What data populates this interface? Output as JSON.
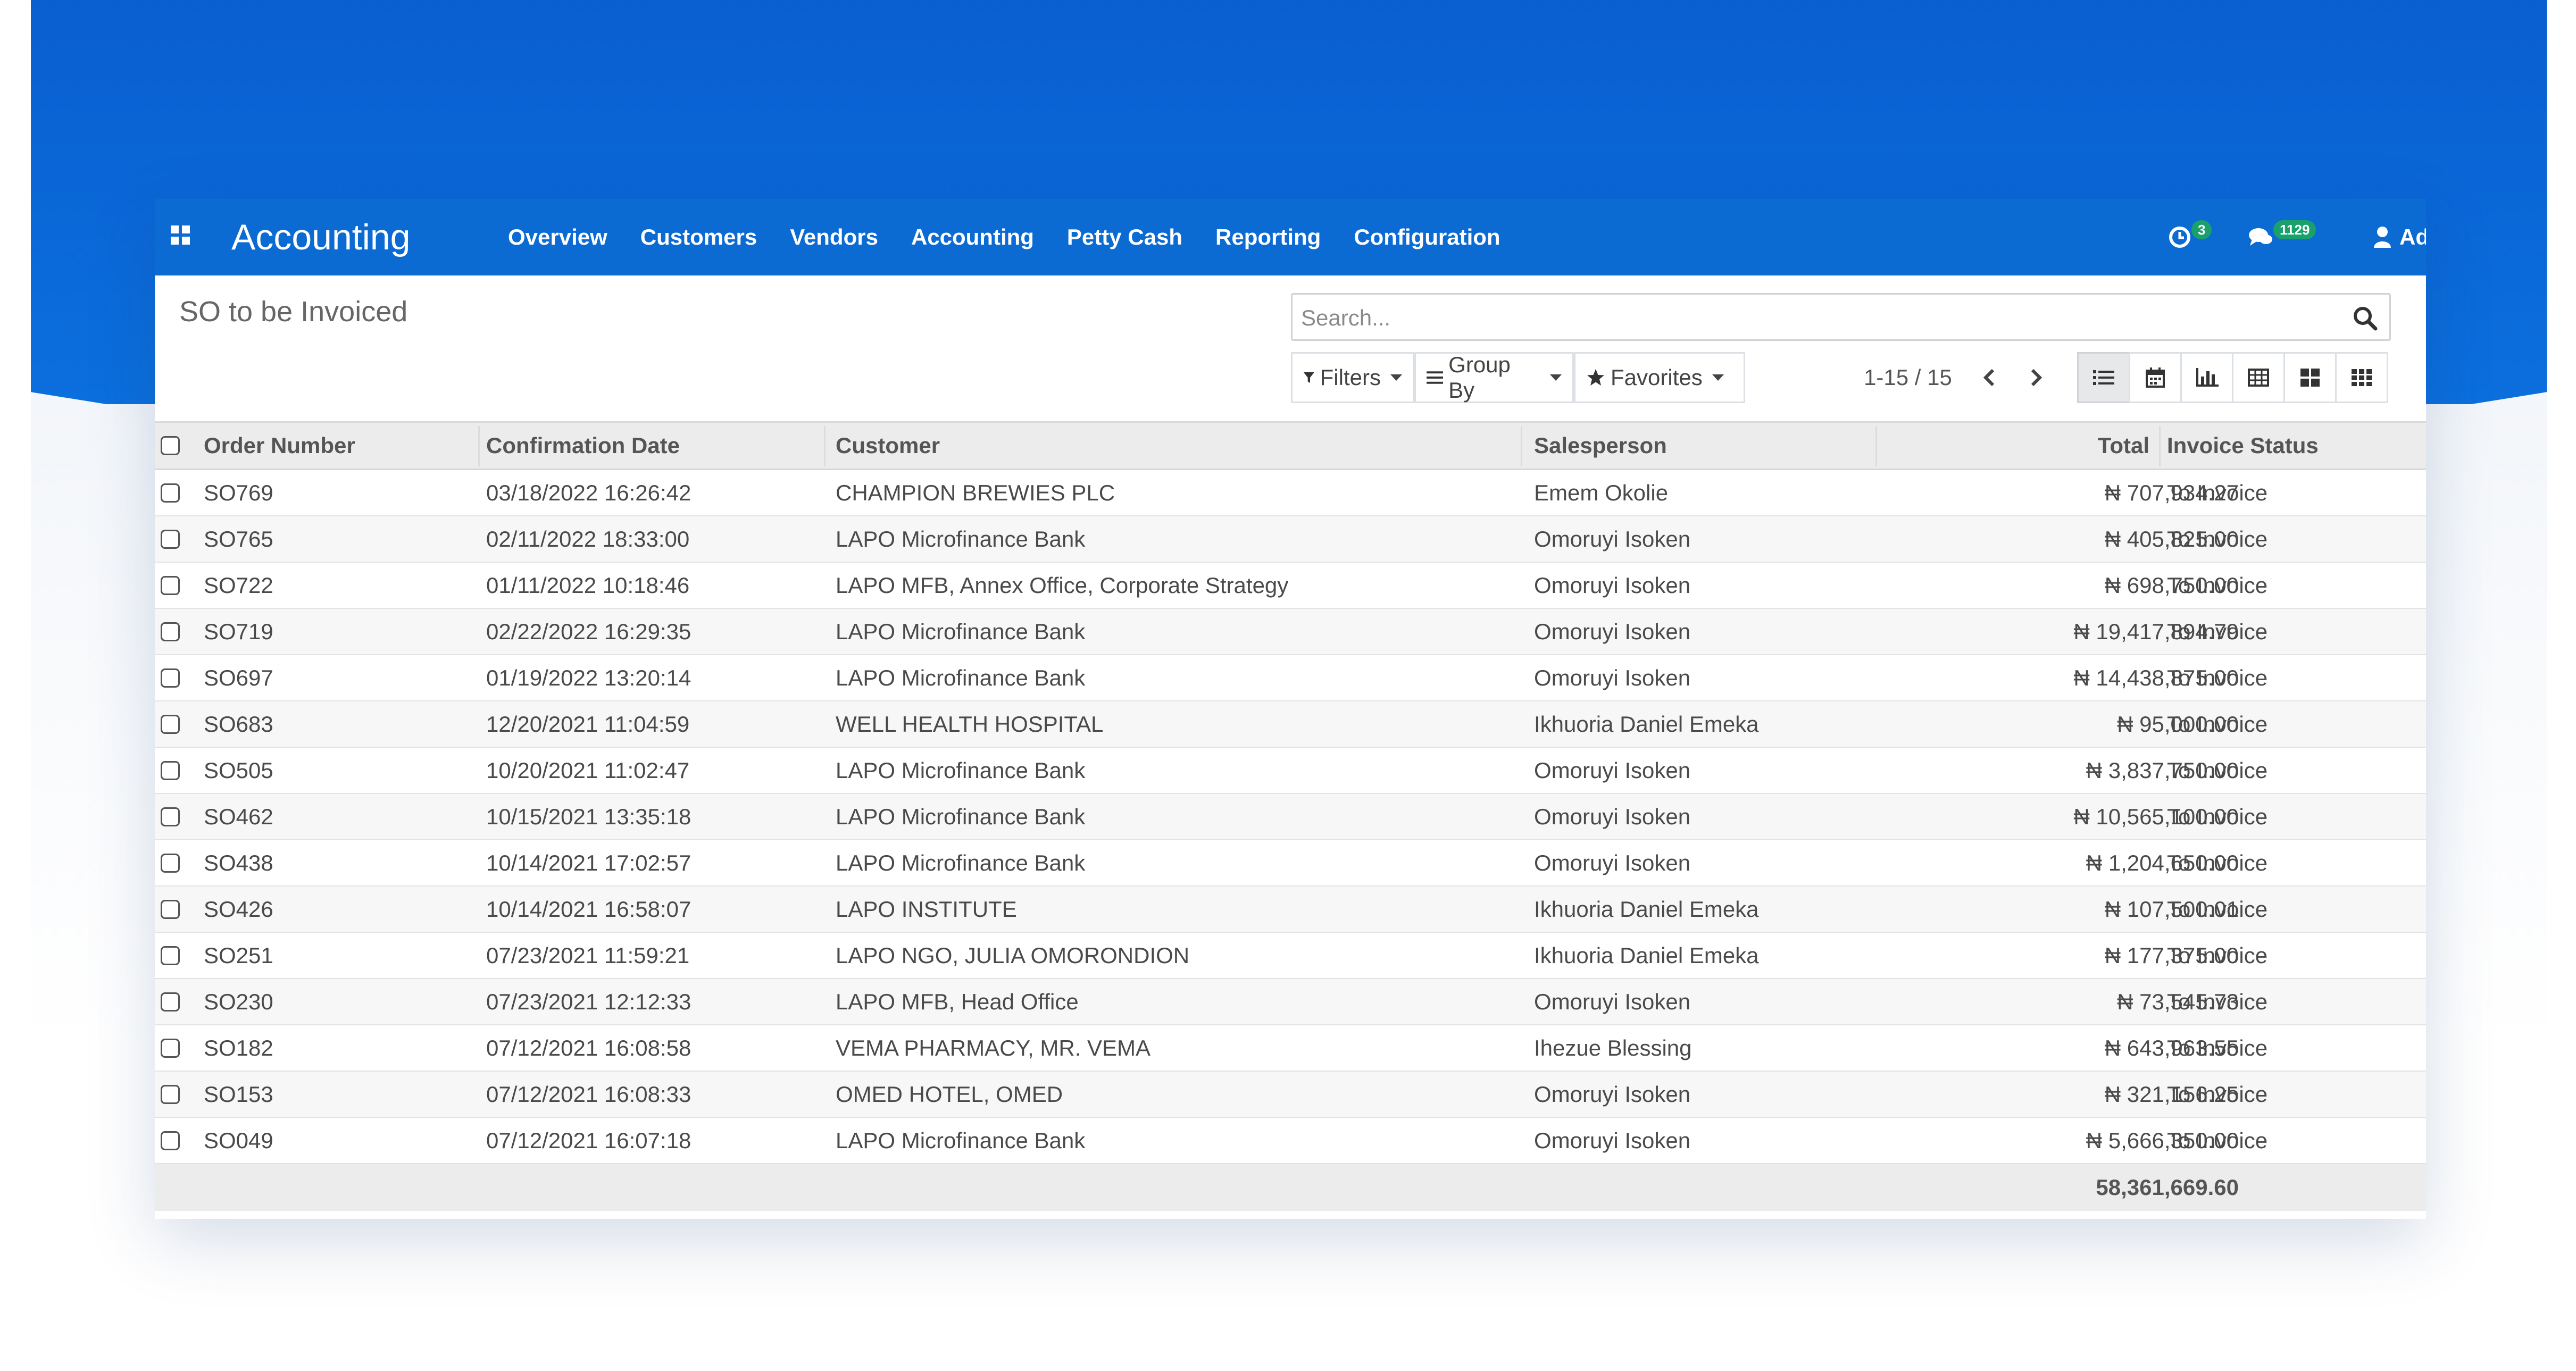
{
  "app": {
    "title": "Accounting",
    "menu": [
      "Overview",
      "Customers",
      "Vendors",
      "Accounting",
      "Petty Cash",
      "Reporting",
      "Configuration"
    ],
    "activity_count": "3",
    "message_count": "1129",
    "user": "Administrator"
  },
  "control_panel": {
    "page_title": "SO to be Invoiced",
    "search_placeholder": "Search...",
    "filters_label": "Filters",
    "groupby_label": "Group By",
    "favorites_label": "Favorites",
    "pager_text": "1-15 / 15"
  },
  "table": {
    "columns": [
      "Order Number",
      "Confirmation Date",
      "Customer",
      "Salesperson",
      "Total",
      "Invoice Status"
    ],
    "rows": [
      {
        "order": "SO769",
        "date": "03/18/2022 16:26:42",
        "customer": "CHAMPION BREWIES PLC",
        "salesperson": "Emem Okolie",
        "total": "₦ 707,934.27",
        "status": "To Invoice"
      },
      {
        "order": "SO765",
        "date": "02/11/2022 18:33:00",
        "customer": "LAPO Microfinance Bank",
        "salesperson": "Omoruyi Isoken",
        "total": "₦ 405,825.00",
        "status": "To Invoice"
      },
      {
        "order": "SO722",
        "date": "01/11/2022 10:18:46",
        "customer": "LAPO MFB, Annex Office, Corporate Strategy",
        "salesperson": "Omoruyi Isoken",
        "total": "₦ 698,750.00",
        "status": "To Invoice"
      },
      {
        "order": "SO719",
        "date": "02/22/2022 16:29:35",
        "customer": "LAPO Microfinance Bank",
        "salesperson": "Omoruyi Isoken",
        "total": "₦ 19,417,894.79",
        "status": "To Invoice"
      },
      {
        "order": "SO697",
        "date": "01/19/2022 13:20:14",
        "customer": "LAPO Microfinance Bank",
        "salesperson": "Omoruyi Isoken",
        "total": "₦ 14,438,875.00",
        "status": "To Invoice"
      },
      {
        "order": "SO683",
        "date": "12/20/2021 11:04:59",
        "customer": "WELL HEALTH HOSPITAL",
        "salesperson": "Ikhuoria Daniel Emeka",
        "total": "₦ 95,000.00",
        "status": "To Invoice"
      },
      {
        "order": "SO505",
        "date": "10/20/2021 11:02:47",
        "customer": "LAPO Microfinance Bank",
        "salesperson": "Omoruyi Isoken",
        "total": "₦ 3,837,750.00",
        "status": "To Invoice"
      },
      {
        "order": "SO462",
        "date": "10/15/2021 13:35:18",
        "customer": "LAPO Microfinance Bank",
        "salesperson": "Omoruyi Isoken",
        "total": "₦ 10,565,100.00",
        "status": "To Invoice"
      },
      {
        "order": "SO438",
        "date": "10/14/2021 17:02:57",
        "customer": "LAPO Microfinance Bank",
        "salesperson": "Omoruyi Isoken",
        "total": "₦ 1,204,650.00",
        "status": "To Invoice"
      },
      {
        "order": "SO426",
        "date": "10/14/2021 16:58:07",
        "customer": "LAPO INSTITUTE",
        "salesperson": "Ikhuoria Daniel Emeka",
        "total": "₦ 107,500.01",
        "status": "To Invoice"
      },
      {
        "order": "SO251",
        "date": "07/23/2021 11:59:21",
        "customer": "LAPO NGO, JULIA OMORONDION",
        "salesperson": "Ikhuoria Daniel Emeka",
        "total": "₦ 177,375.00",
        "status": "To Invoice"
      },
      {
        "order": "SO230",
        "date": "07/23/2021 12:12:33",
        "customer": "LAPO MFB, Head Office",
        "salesperson": "Omoruyi Isoken",
        "total": "₦ 73,545.73",
        "status": "To Invoice"
      },
      {
        "order": "SO182",
        "date": "07/12/2021 16:08:58",
        "customer": "VEMA PHARMACY, MR. VEMA",
        "salesperson": "Ihezue Blessing",
        "total": "₦ 643,963.55",
        "status": "To Invoice"
      },
      {
        "order": "SO153",
        "date": "07/12/2021 16:08:33",
        "customer": "OMED HOTEL, OMED",
        "salesperson": "Omoruyi Isoken",
        "total": "₦ 321,156.25",
        "status": "To Invoice"
      },
      {
        "order": "SO049",
        "date": "07/12/2021 16:07:18",
        "customer": "LAPO Microfinance Bank",
        "salesperson": "Omoruyi Isoken",
        "total": "₦ 5,666,350.00",
        "status": "To Invoice"
      }
    ],
    "sum_total": "58,361,669.60"
  }
}
